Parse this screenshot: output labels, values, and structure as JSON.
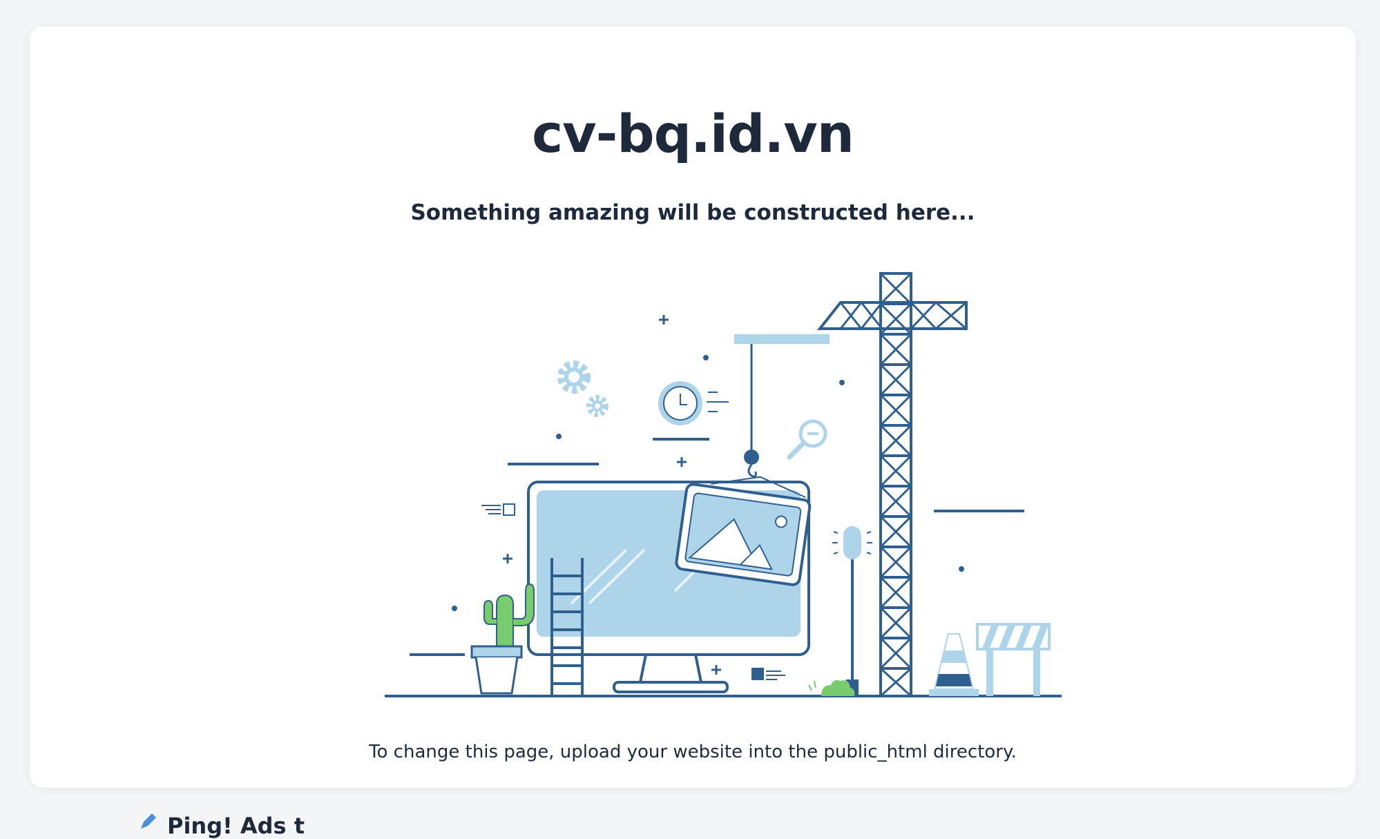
{
  "page": {
    "title": "cv-bq.id.vn",
    "subtitle": "Something amazing will be constructed here...",
    "note": "To change this page, upload your website into the public_html directory."
  },
  "bottom_peek": {
    "label": "Ping! Ads t"
  },
  "illustration": {
    "icons": [
      "gear-icon",
      "clock-icon",
      "magnifier-icon",
      "picture-icon",
      "crane-icon",
      "traffic-cone-icon",
      "barrier-icon",
      "cactus-icon",
      "ladder-icon",
      "monitor-icon",
      "street-lamp-icon"
    ]
  },
  "colors": {
    "primary_dark": "#2f5f8f",
    "light_blue": "#aed4ea",
    "green": "#78cc6d",
    "text": "#1e2a3c",
    "background": "#f4f5f7",
    "card": "#ffffff"
  }
}
